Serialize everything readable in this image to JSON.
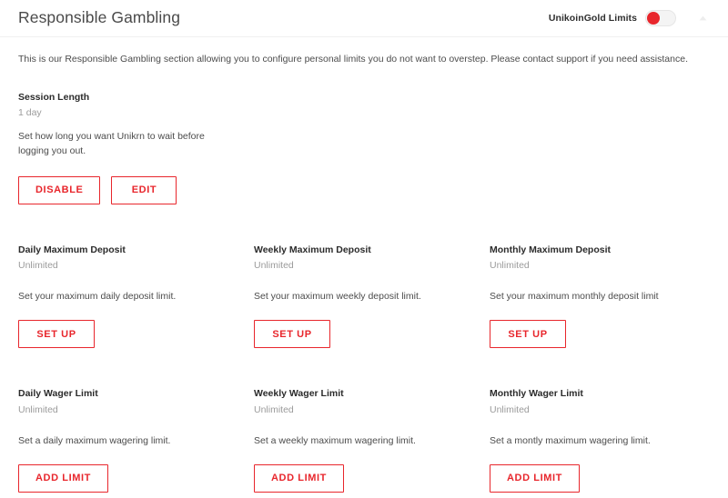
{
  "header": {
    "title": "Responsible Gambling",
    "toggle_label": "UnikoinGold Limits",
    "toggle_state": "on",
    "accent_color": "#e8262c",
    "collapse_icon": "caret-up-icon"
  },
  "intro": {
    "text": "This is our Responsible Gambling section allowing you to configure personal limits you do not want to overstep. Please contact support if you need assistance."
  },
  "session": {
    "title": "Session Length",
    "value": "1 day",
    "description": "Set how long you want Unikrn to wait before logging you out.",
    "disable_label": "DISABLE",
    "edit_label": "EDIT"
  },
  "deposit_limits": [
    {
      "title": "Daily Maximum Deposit",
      "value": "Unlimited",
      "description": "Set your maximum daily deposit limit.",
      "action_label": "SET UP"
    },
    {
      "title": "Weekly Maximum Deposit",
      "value": "Unlimited",
      "description": "Set your maximum weekly deposit limit.",
      "action_label": "SET UP"
    },
    {
      "title": "Monthly Maximum Deposit",
      "value": "Unlimited",
      "description": "Set your maximum monthly deposit limit",
      "action_label": "SET UP"
    }
  ],
  "wager_limits": [
    {
      "title": "Daily Wager Limit",
      "value": "Unlimited",
      "description": "Set a daily maximum wagering limit.",
      "action_label": "ADD LIMIT"
    },
    {
      "title": "Weekly Wager Limit",
      "value": "Unlimited",
      "description": "Set a weekly maximum wagering limit.",
      "action_label": "ADD LIMIT"
    },
    {
      "title": "Monthly Wager Limit",
      "value": "Unlimited",
      "description": "Set a montly maximum wagering limit.",
      "action_label": "ADD LIMIT"
    }
  ]
}
